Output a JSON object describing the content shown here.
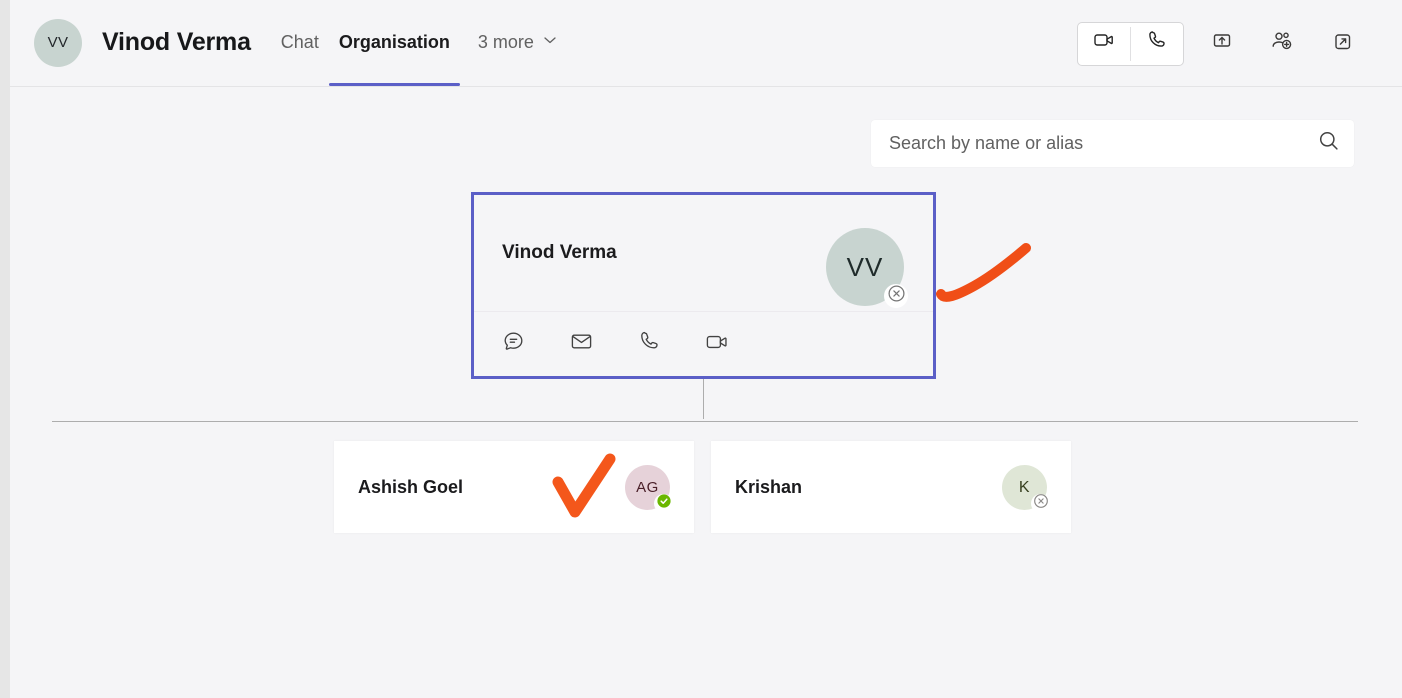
{
  "header": {
    "avatar_initials": "VV",
    "title": "Vinod Verma",
    "tabs": [
      {
        "label": "Chat",
        "active": false
      },
      {
        "label": "Organisation",
        "active": true
      }
    ],
    "more_label": "3 more",
    "more_icon": "chevron-down-icon",
    "actions": [
      {
        "name": "video-call-icon",
        "label": "Video call"
      },
      {
        "name": "audio-call-icon",
        "label": "Audio call"
      },
      {
        "name": "share-icon",
        "label": "Share"
      },
      {
        "name": "add-people-icon",
        "label": "Add people"
      },
      {
        "name": "pop-out-icon",
        "label": "Open in new window"
      }
    ]
  },
  "search": {
    "placeholder": "Search by name or alias",
    "value": "",
    "icon": "search-icon"
  },
  "org_chart": {
    "root": {
      "name": "Vinod Verma",
      "initials": "VV",
      "presence": "offline",
      "selected": true,
      "avatar_color": "#c8d4d0",
      "border_color": "#5b5fc7",
      "actions": [
        {
          "name": "chat-icon",
          "label": "Chat"
        },
        {
          "name": "mail-icon",
          "label": "Email"
        },
        {
          "name": "call-icon",
          "label": "Call"
        },
        {
          "name": "video-icon",
          "label": "Video call"
        }
      ]
    },
    "children": [
      {
        "name": "Ashish Goel",
        "initials": "AG",
        "presence": "available",
        "avatar_color": "#e6d2d9",
        "presence_color": "#6bb700"
      },
      {
        "name": "Krishan",
        "initials": "K",
        "presence": "offline",
        "avatar_color": "#dfe6d6",
        "presence_color": "#8a8886"
      }
    ]
  },
  "annotations": [
    {
      "name": "orange-swoosh-annotation",
      "type": "curve",
      "color": "#f04e17"
    },
    {
      "name": "orange-checkmark-annotation",
      "type": "check",
      "color": "#f4571b"
    }
  ],
  "theme": {
    "accent": "#5b5fc7",
    "background": "#f5f5f7",
    "card": "#ffffff",
    "annotation": "#f4571b"
  }
}
